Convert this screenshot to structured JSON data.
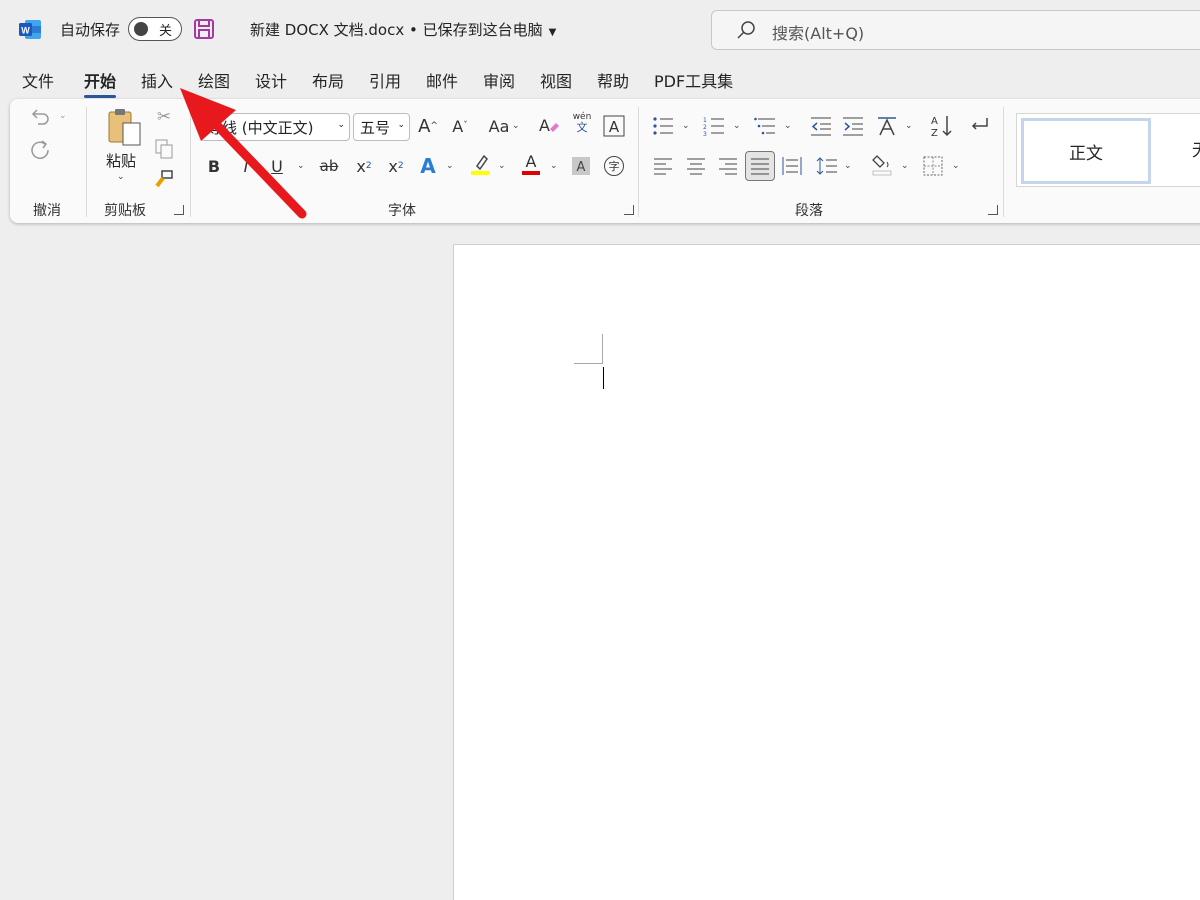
{
  "titlebar": {
    "autosave_label": "自动保存",
    "autosave_state": "关",
    "document_title": "新建 DOCX 文档.docx • 已保存到这台电脑",
    "search_placeholder": "搜索(Alt+Q)"
  },
  "tabs": [
    "文件",
    "开始",
    "插入",
    "绘图",
    "设计",
    "布局",
    "引用",
    "邮件",
    "审阅",
    "视图",
    "帮助",
    "PDF工具集"
  ],
  "active_tab": "开始",
  "ribbon": {
    "groups": {
      "undo": "撤消",
      "clipboard": "剪贴板",
      "font": "字体",
      "paragraph": "段落"
    },
    "paste_label": "粘贴",
    "font_name": "等线 (中文正文)",
    "font_size": "五号",
    "change_case": "Aa",
    "phonetic_top": "wén",
    "phonetic_bottom": "文",
    "bold": "B",
    "italic": "I",
    "underline": "U",
    "strike": "ab",
    "subscript": "x",
    "superscript": "x",
    "styles": [
      "正文",
      "无"
    ]
  },
  "colors": {
    "accent": "#2b579a",
    "highlight": "#ffff00",
    "font_color": "#e00000",
    "arrow": "#e8191c",
    "save_icon": "#a33aa3"
  }
}
